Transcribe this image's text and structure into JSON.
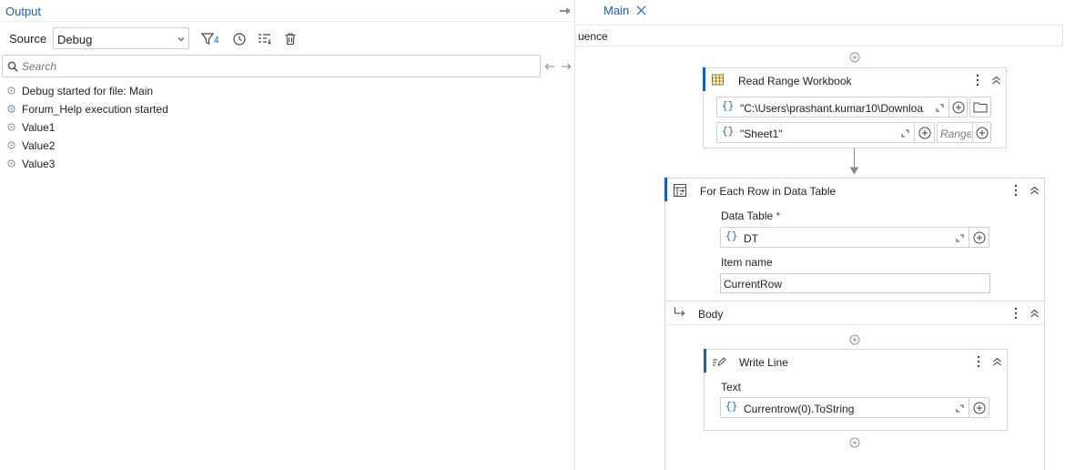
{
  "output": {
    "title": "Output",
    "source_label": "Source",
    "source_value": "Debug",
    "filter_count": "4",
    "search_placeholder": "Search",
    "logs": [
      {
        "text": "Debug started for file: Main",
        "color": "#8a8a8a"
      },
      {
        "text": "Forum_Help execution started",
        "color": "#5b7fc2"
      },
      {
        "text": "Value1",
        "color": "#8a8a8a"
      },
      {
        "text": "Value2",
        "color": "#8a8a8a"
      },
      {
        "text": "Value3",
        "color": "#8a8a8a"
      }
    ]
  },
  "designer": {
    "tab_label": "Main",
    "breadcrumb": "uence",
    "read_range": {
      "title": "Read Range Workbook",
      "path_value": "\"C:\\Users\\prashant.kumar10\\Downloa",
      "sheet_value": "\"Sheet1\"",
      "range_placeholder": "Range"
    },
    "for_each": {
      "title": "For Each Row in Data Table",
      "data_table_label": "Data Table",
      "required_mark": "*",
      "data_table_value": "DT",
      "item_name_label": "Item name",
      "item_name_value": "CurrentRow",
      "body_label": "Body"
    },
    "write_line": {
      "title": "Write Line",
      "text_label": "Text",
      "text_value": "Currentrow(0).ToString"
    }
  },
  "colors": {
    "accent": "#1a5fb4",
    "border": "#d8d8d8"
  }
}
